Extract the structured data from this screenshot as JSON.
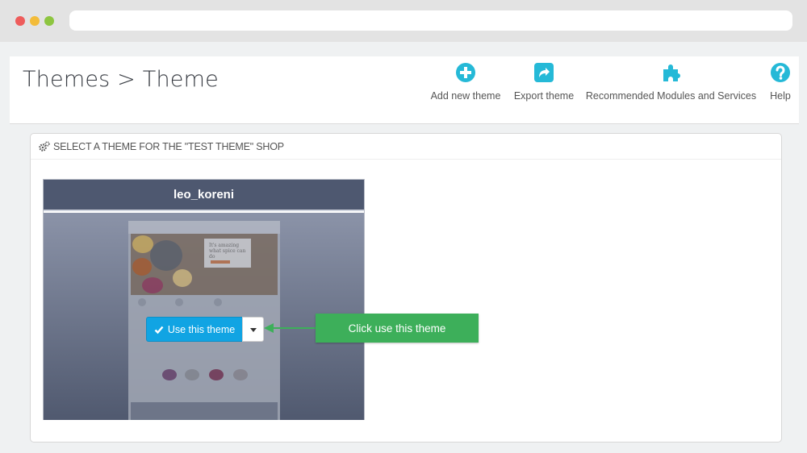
{
  "page": {
    "title": "Themes > Theme"
  },
  "toolbar": {
    "items": [
      {
        "label": "Add new theme",
        "icon": "plus-circle-icon"
      },
      {
        "label": "Export theme",
        "icon": "share-icon"
      },
      {
        "label": "Recommended Modules and Services",
        "icon": "puzzle-icon"
      },
      {
        "label": "Help",
        "icon": "question-circle-icon"
      }
    ]
  },
  "panel": {
    "heading": "SELECT A THEME FOR THE \"TEST THEME\" SHOP",
    "heading_icon": "cogs-icon"
  },
  "theme_card": {
    "name": "leo_koreni",
    "use_button_label": "Use this theme",
    "thumbnail_caption": "It's amazing what spice can do"
  },
  "callout": {
    "text": "Click use this theme"
  },
  "colors": {
    "accent": "#25b9d7",
    "primary_button": "#11a4e3",
    "callout": "#3daf5a",
    "card_header": "#4e5870"
  }
}
